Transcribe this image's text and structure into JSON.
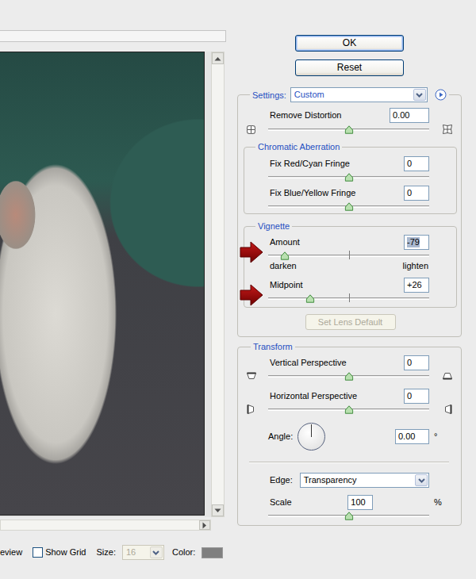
{
  "buttons": [
    {
      "label": "OK",
      "default": true
    },
    {
      "label": "Reset",
      "default": false
    }
  ],
  "settings": {
    "label": "Settings:",
    "value": "Custom",
    "distortion": {
      "label": "Remove Distortion",
      "value": "0.00",
      "level": 0.5
    }
  },
  "groups": [
    {
      "title": "Chromatic Aberration",
      "sliders": [
        {
          "label": "Fix Red/Cyan Fringe",
          "value": "0",
          "level": 0.5,
          "kind": "plain",
          "selected": false,
          "arrow": false
        },
        {
          "label": "Fix Blue/Yellow Fringe",
          "value": "0",
          "level": 0.5,
          "kind": "plain",
          "selected": false,
          "arrow": false
        }
      ]
    },
    {
      "title": "Vignette",
      "sliders": [
        {
          "label": "Amount",
          "value": "-79",
          "level": 0.105,
          "kind": "centered",
          "selected": true,
          "arrow": true
        },
        {
          "label": "Midpoint",
          "value": "+26",
          "level": 0.26,
          "kind": "centered",
          "selected": false,
          "arrow": true
        }
      ],
      "ends": [
        "darken",
        "lighten"
      ]
    }
  ],
  "lens_default": {
    "label": "Set Lens Default",
    "disabled": true
  },
  "transform": {
    "title": "Transform",
    "sliders": [
      {
        "label": "Vertical Perspective",
        "value": "0",
        "level": 0.5
      },
      {
        "label": "Horizontal Perspective",
        "value": "0",
        "level": 0.5
      }
    ],
    "angle": {
      "label": "Angle:",
      "value": "0.00",
      "unit": "°"
    },
    "edge": {
      "label": "Edge:",
      "value": "Transparency"
    },
    "scale": {
      "label": "Scale",
      "value": "100",
      "unit": "%",
      "level": 0.5
    }
  },
  "footer": {
    "preview": "eview",
    "show_grid": {
      "label": "Show Grid",
      "checked": false
    },
    "size": {
      "label": "Size:",
      "value": "16",
      "disabled": true
    },
    "color": {
      "label": "Color:"
    }
  }
}
